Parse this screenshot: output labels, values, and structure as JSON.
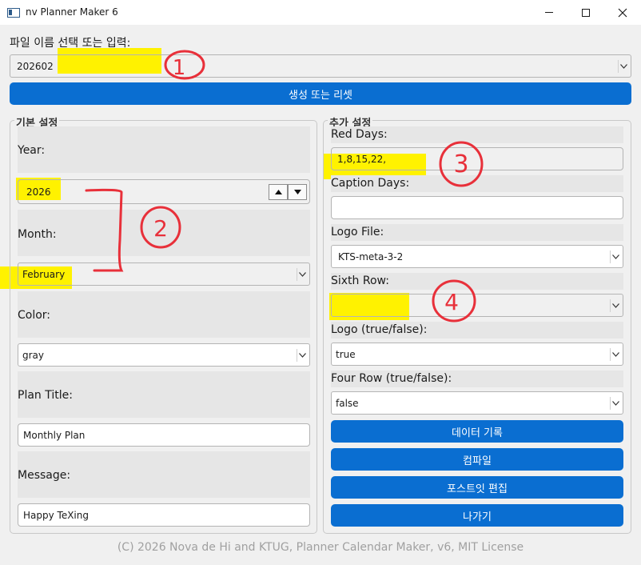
{
  "window": {
    "title": "nv Planner Maker 6"
  },
  "file": {
    "label": "파일 이름 선택 또는 입력:",
    "value": "202602",
    "button": "생성 또는 리셋"
  },
  "basic": {
    "title": "기본 설정",
    "year_label": "Year:",
    "year_value": "2026",
    "month_label": "Month:",
    "month_value": "February",
    "color_label": "Color:",
    "color_value": "gray",
    "plan_title_label": "Plan Title:",
    "plan_title_value": "Monthly Plan",
    "message_label": "Message:",
    "message_value": "Happy TeXing"
  },
  "extra": {
    "title": "추가 설정",
    "red_days_label": "Red Days:",
    "red_days_value": "1,8,15,22,",
    "caption_days_label": "Caption Days:",
    "caption_days_value": "",
    "logo_file_label": "Logo File:",
    "logo_file_value": "KTS-meta-3-2",
    "sixth_row_label": "Sixth Row:",
    "sixth_row_value": "",
    "logo_label": "Logo (true/false):",
    "logo_value": "true",
    "four_row_label": "Four Row (true/false):",
    "four_row_value": "false"
  },
  "actions": {
    "record": "데이터 기록",
    "compile": "컴파일",
    "postit": "포스트잇 편집",
    "exit": "나가기"
  },
  "footer": "(C) 2026 Nova de Hi and KTUG, Planner Calendar Maker, v6, MIT License",
  "annotations": {
    "mark1": "1",
    "mark2": "2",
    "mark3": "3",
    "mark4": "4"
  },
  "colors": {
    "accent": "#0a6ed1",
    "highlight": "#fff200",
    "annotation": "#e8303a"
  }
}
